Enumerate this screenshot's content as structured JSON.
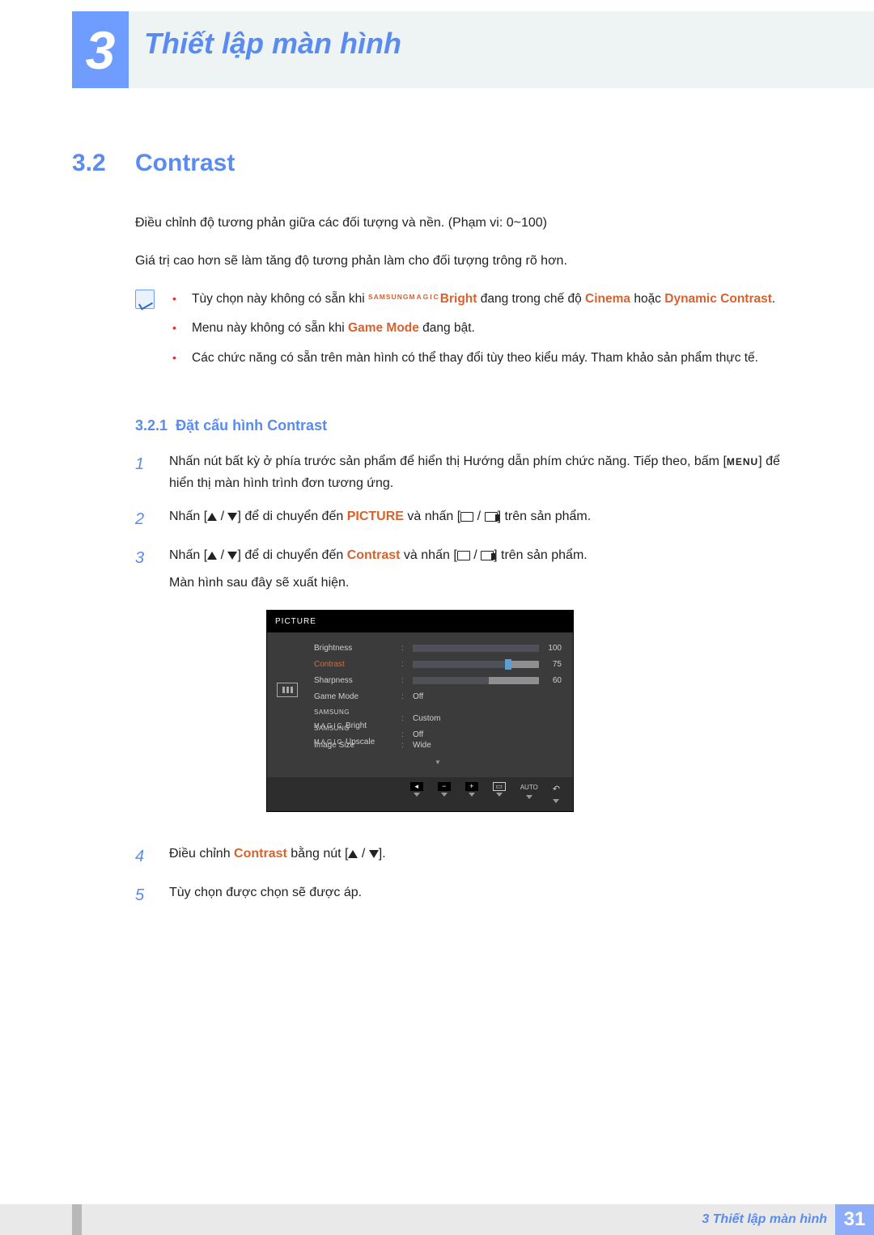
{
  "chapter": {
    "number": "3",
    "title": "Thiết lập màn hình"
  },
  "section": {
    "number": "3.2",
    "title": "Contrast",
    "p1": "Điều chỉnh độ tương phản giữa các đối tượng và nền. (Phạm vi: 0~100)",
    "p2": "Giá trị cao hơn sẽ làm tăng độ tương phản làm cho đối tượng trông rõ hơn."
  },
  "notes": {
    "n1_a": "Tùy chọn này không có sẵn khi ",
    "n1_magic_prefix": "SAMSUNG",
    "n1_magic_label": "MAGIC",
    "n1_bright": "Bright",
    "n1_b": " đang trong chế độ ",
    "n1_cinema": "Cinema",
    "n1_or": " hoặc ",
    "n1_dc": "Dynamic Contrast",
    "n1_end": ".",
    "n2_a": "Menu này không có sẵn khi ",
    "n2_gm": "Game Mode",
    "n2_b": " đang bật.",
    "n3": "Các chức năng có sẵn trên màn hình có thể thay đổi tùy theo kiểu máy. Tham khảo sản phẩm thực tế."
  },
  "subsection": {
    "number": "3.2.1",
    "title": "Đặt cấu hình Contrast"
  },
  "steps": {
    "s1_a": "Nhấn nút bất kỳ ở phía trước sản phẩm để hiển thị Hướng dẫn phím chức năng. Tiếp theo, bấm [",
    "s1_menu": "MENU",
    "s1_b": "] để hiển thị màn hình trình đơn tương ứng.",
    "s2_a": "Nhấn [",
    "s2_b": "] để di chuyển đến ",
    "s2_pic": "PICTURE",
    "s2_c": " và nhấn [",
    "s2_d": "] trên sản phẩm.",
    "s3_a": "Nhấn [",
    "s3_b": "] để di chuyển đến ",
    "s3_c": "Contrast",
    "s3_d": " và nhấn [",
    "s3_e": "] trên sản phẩm.",
    "s3_line2": "Màn hình sau đây sẽ xuất hiện.",
    "s4_a": "Điều chỉnh ",
    "s4_c": "Contrast",
    "s4_b": " bằng nút [",
    "s4_d": "].",
    "s5": "Tùy chọn được chọn sẽ được áp."
  },
  "step_numbers": {
    "n1": "1",
    "n2": "2",
    "n3": "3",
    "n4": "4",
    "n5": "5"
  },
  "osd": {
    "title": "PICTURE",
    "rows": {
      "brightness": {
        "label": "Brightness",
        "value": 100
      },
      "contrast": {
        "label": "Contrast",
        "value": 75
      },
      "sharpness": {
        "label": "Sharpness",
        "value": 60
      },
      "gamemode": {
        "label": "Game Mode",
        "text": "Off"
      },
      "magicbright": {
        "prefix": "SAMSUNG",
        "magic": "MAGIC",
        "suffix": "Bright",
        "text": "Custom"
      },
      "magicupscale": {
        "prefix": "SAMSUNG",
        "magic": "MAGIC",
        "suffix": "Upscale",
        "text": "Off"
      },
      "imagesize": {
        "label": "Image Size",
        "text": "Wide"
      }
    },
    "footer": {
      "auto": "AUTO",
      "return_glyph": "↶",
      "minus": "−",
      "plus": "+"
    }
  },
  "footer": {
    "text": "3 Thiết lập màn hình",
    "page": "31"
  }
}
